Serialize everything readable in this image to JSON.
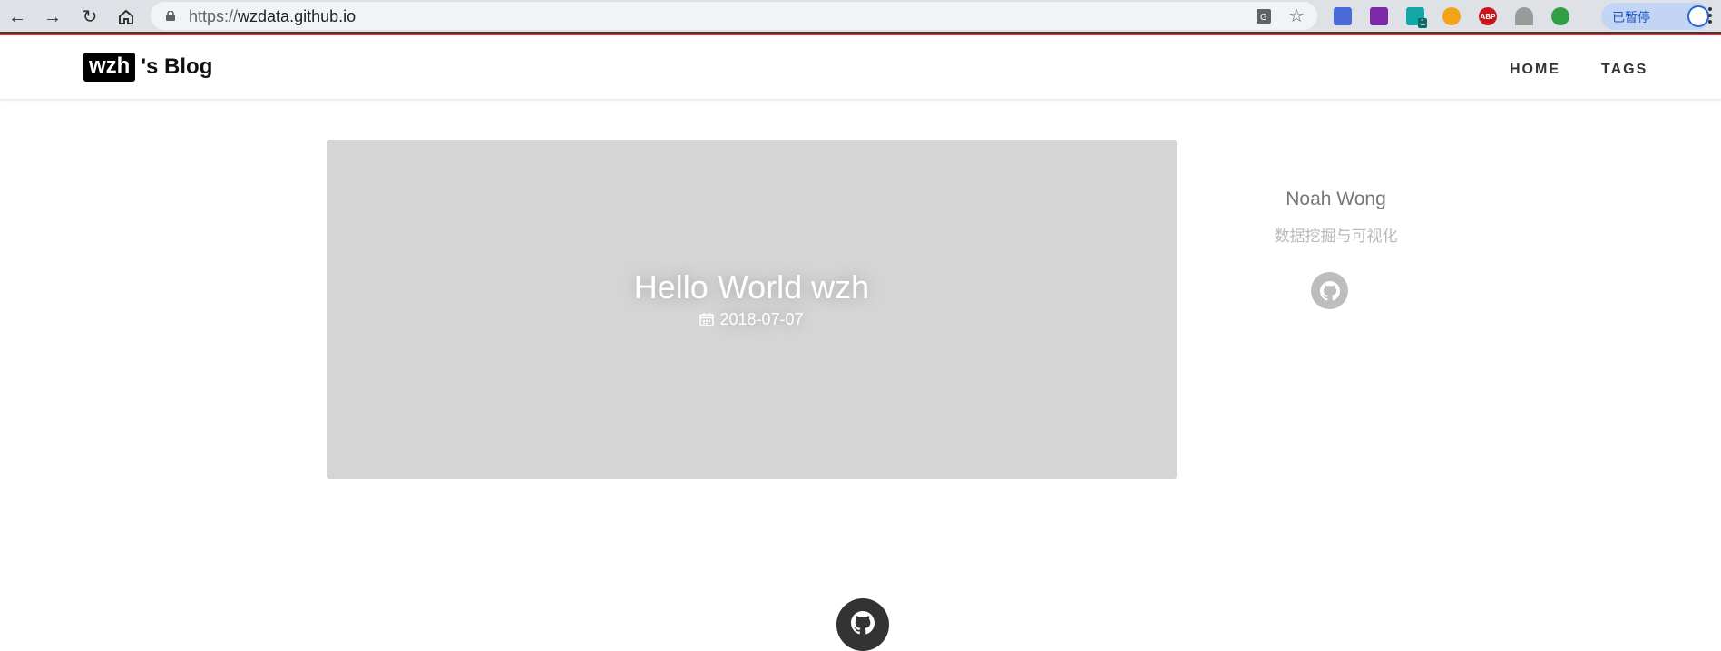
{
  "browser": {
    "url_scheme": "https://",
    "url_host": "wzdata.github.io",
    "paused_label": "已暂停",
    "extensions": [
      "reader-icon",
      "onenote-icon",
      "s-extension-icon",
      "colorful-globe-icon",
      "adblock-icon",
      "parachute-icon",
      "chrome-store-icon"
    ],
    "s_extension_badge": "1",
    "abp_label": "ABP"
  },
  "site": {
    "brand_box": "wzh",
    "brand_rest": "'s Blog",
    "nav": [
      "HOME",
      "TAGS"
    ]
  },
  "post": {
    "title": "Hello World wzh",
    "date": "2018-07-07"
  },
  "sidebar": {
    "author": "Noah Wong",
    "bio": "数据挖掘与可视化"
  },
  "colors": {
    "accent_line": "#e8323a",
    "card_bg": "#d5d5d5",
    "header_text": "#111111"
  }
}
